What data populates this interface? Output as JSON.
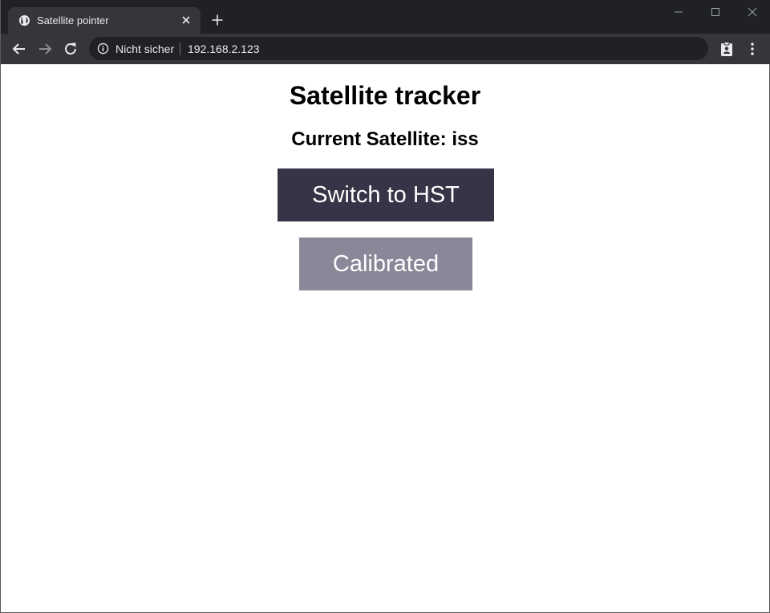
{
  "browser": {
    "tab": {
      "title": "Satellite pointer"
    },
    "address_bar": {
      "security_label": "Nicht sicher",
      "url": "192.168.2.123"
    },
    "colors": {
      "frame": "#202124",
      "toolbar": "#35363a",
      "text": "#e8eaed"
    }
  },
  "page": {
    "heading": "Satellite tracker",
    "current_satellite_label": "Current Satellite: iss",
    "switch_button_label": "Switch to HST",
    "calibrated_button_label": "Calibrated",
    "colors": {
      "switch_button": "#363447",
      "calibrated_button": "#888899"
    }
  }
}
